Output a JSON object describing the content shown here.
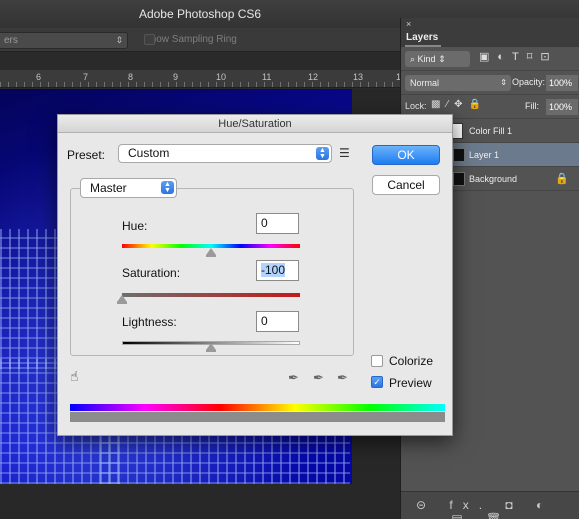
{
  "app": {
    "title": "Adobe Photoshop CS6"
  },
  "options_bar": {
    "sample_size_value": "ers",
    "show_sampling_ring_label": "Show Sampling Ring"
  },
  "ruler": {
    "ticks": [
      "6",
      "7",
      "8",
      "9",
      "10",
      "11",
      "12",
      "13",
      "1"
    ]
  },
  "layers_panel": {
    "close_symbol": "×",
    "tab_label": "Layers",
    "filter_kind_label": "Kind",
    "blend_mode": "Normal",
    "opacity_label": "Opacity:",
    "opacity_value": "100%",
    "lock_label": "Lock:",
    "fill_label": "Fill:",
    "fill_value": "100%",
    "layers": [
      {
        "name": "Color Fill 1"
      },
      {
        "name": "Layer 1",
        "selected": true
      },
      {
        "name": "Background",
        "locked": true
      }
    ],
    "bottom_icons_text": "fx."
  },
  "dialog": {
    "title": "Hue/Saturation",
    "preset_label": "Preset:",
    "preset_value": "Custom",
    "ok_label": "OK",
    "cancel_label": "Cancel",
    "channel_value": "Master",
    "hue_label": "Hue:",
    "hue_value": "0",
    "hue_level": 0.5,
    "saturation_label": "Saturation:",
    "saturation_value": "-100",
    "saturation_level": 0.0,
    "lightness_label": "Lightness:",
    "lightness_value": "0",
    "lightness_level": 0.5,
    "colorize_label": "Colorize",
    "colorize_checked": false,
    "preview_label": "Preview",
    "preview_checked": true
  }
}
